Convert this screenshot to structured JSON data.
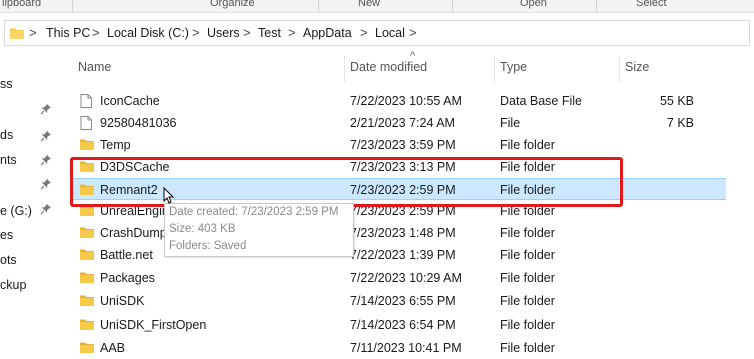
{
  "ribbon": {
    "groups": [
      "lipboard",
      "Organize",
      "New",
      "Open",
      "Select"
    ]
  },
  "address": {
    "crumbs": [
      "This PC",
      "Local Disk (C:)",
      "Users",
      "Test",
      "AppData",
      "Local"
    ],
    "separator": ">"
  },
  "sidebar": {
    "items": [
      "ss",
      "ds",
      "nts",
      "e (G:)",
      "es",
      "ots",
      "ckup"
    ]
  },
  "columns": {
    "name": "Name",
    "date": "Date modified",
    "type": "Type",
    "size": "Size",
    "sort_glyph": "^"
  },
  "files": [
    {
      "name": "IconCache",
      "date": "7/22/2023 10:55 AM",
      "type": "Data Base File",
      "size": "55 KB",
      "icon": "file-icon"
    },
    {
      "name": "92580481036",
      "date": "2/21/2023 7:24 AM",
      "type": "File",
      "size": "7 KB",
      "icon": "file-icon"
    },
    {
      "name": "Temp",
      "date": "7/23/2023 3:59 PM",
      "type": "File folder",
      "size": "",
      "icon": "folder-icon"
    },
    {
      "name": "D3DSCache",
      "date": "7/23/2023 3:13 PM",
      "type": "File folder",
      "size": "",
      "icon": "folder-icon"
    },
    {
      "name": "Remnant2",
      "date": "7/23/2023 2:59 PM",
      "type": "File folder",
      "size": "",
      "icon": "folder-icon"
    },
    {
      "name": "UnrealEngine",
      "date": "7/23/2023 2:59 PM",
      "type": "File folder",
      "size": "",
      "icon": "folder-icon"
    },
    {
      "name": "CrashDumps",
      "date": "7/23/2023 1:48 PM",
      "type": "File folder",
      "size": "",
      "icon": "folder-icon"
    },
    {
      "name": "Battle.net",
      "date": "7/22/2023 1:39 PM",
      "type": "File folder",
      "size": "",
      "icon": "folder-icon"
    },
    {
      "name": "Packages",
      "date": "7/22/2023 10:29 AM",
      "type": "File folder",
      "size": "",
      "icon": "folder-icon"
    },
    {
      "name": "UniSDK",
      "date": "7/14/2023 6:55 PM",
      "type": "File folder",
      "size": "",
      "icon": "folder-icon"
    },
    {
      "name": "UniSDK_FirstOpen",
      "date": "7/14/2023 6:54 PM",
      "type": "File folder",
      "size": "",
      "icon": "folder-icon"
    },
    {
      "name": "AAB",
      "date": "7/11/2023 10:41 PM",
      "type": "File folder",
      "size": "",
      "icon": "folder-icon"
    }
  ],
  "selected_index": 4,
  "tooltip": {
    "date_created": "Date created: 7/23/2023 2:59 PM",
    "size": "Size: 403 KB",
    "folders": "Folders: Saved"
  },
  "colors": {
    "selection": "#cce8ff",
    "highlight": "#e0191b",
    "folder": "#f7c948"
  }
}
